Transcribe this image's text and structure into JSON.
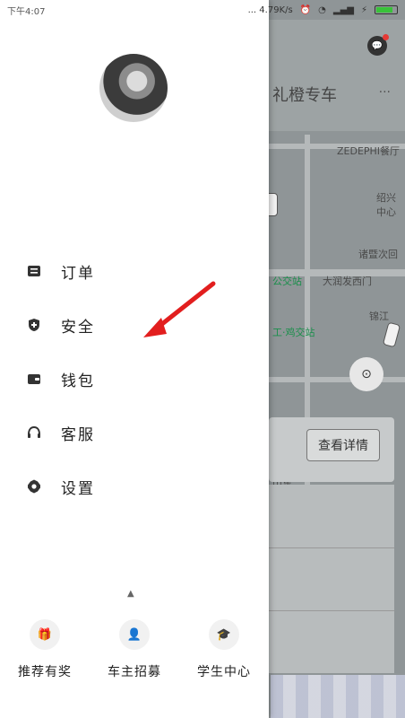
{
  "status_bar": {
    "time": "下午4:07",
    "network_speed": "... 4.79K/s",
    "battery_level": "77%"
  },
  "map": {
    "service_title": "礼橙专车",
    "pois": [
      "ZEDEPHI餐厅",
      "绍兴",
      "中心",
      "诸暨次回",
      "公交站",
      "大润发西门",
      "锦江",
      "工·鸡交站",
      "山东"
    ],
    "details_button": "查看详情"
  },
  "drawer": {
    "menu": [
      {
        "icon": "order-icon",
        "label": "订单"
      },
      {
        "icon": "shield-icon",
        "label": "安全"
      },
      {
        "icon": "wallet-icon",
        "label": "钱包"
      },
      {
        "icon": "headset-icon",
        "label": "客服"
      },
      {
        "icon": "gear-icon",
        "label": "设置"
      }
    ],
    "bottom_nav": [
      {
        "icon": "gift-icon",
        "label": "推荐有奖"
      },
      {
        "icon": "driver-icon",
        "label": "车主招募"
      },
      {
        "icon": "graduation-cap-icon",
        "label": "学生中心"
      }
    ]
  },
  "colors": {
    "highlight": "#e21e1e",
    "drawer_bg": "#ffffff",
    "map_bg": "#8f9597"
  }
}
